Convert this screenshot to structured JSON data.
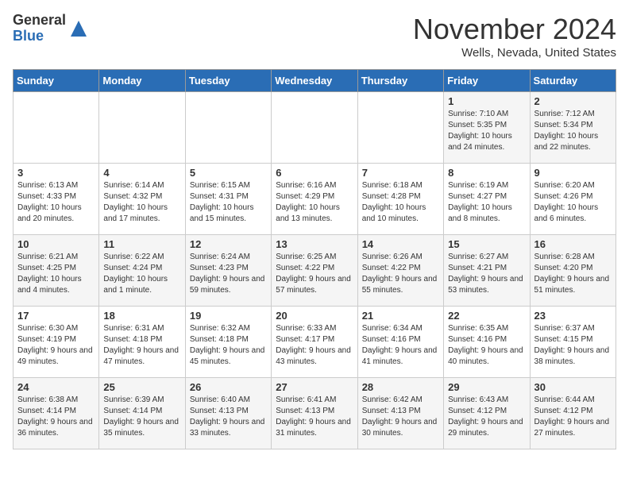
{
  "logo": {
    "general": "General",
    "blue": "Blue"
  },
  "title": "November 2024",
  "location": "Wells, Nevada, United States",
  "days_of_week": [
    "Sunday",
    "Monday",
    "Tuesday",
    "Wednesday",
    "Thursday",
    "Friday",
    "Saturday"
  ],
  "weeks": [
    [
      {
        "day": "",
        "info": ""
      },
      {
        "day": "",
        "info": ""
      },
      {
        "day": "",
        "info": ""
      },
      {
        "day": "",
        "info": ""
      },
      {
        "day": "",
        "info": ""
      },
      {
        "day": "1",
        "info": "Sunrise: 7:10 AM\nSunset: 5:35 PM\nDaylight: 10 hours and 24 minutes."
      },
      {
        "day": "2",
        "info": "Sunrise: 7:12 AM\nSunset: 5:34 PM\nDaylight: 10 hours and 22 minutes."
      }
    ],
    [
      {
        "day": "3",
        "info": "Sunrise: 6:13 AM\nSunset: 4:33 PM\nDaylight: 10 hours and 20 minutes."
      },
      {
        "day": "4",
        "info": "Sunrise: 6:14 AM\nSunset: 4:32 PM\nDaylight: 10 hours and 17 minutes."
      },
      {
        "day": "5",
        "info": "Sunrise: 6:15 AM\nSunset: 4:31 PM\nDaylight: 10 hours and 15 minutes."
      },
      {
        "day": "6",
        "info": "Sunrise: 6:16 AM\nSunset: 4:29 PM\nDaylight: 10 hours and 13 minutes."
      },
      {
        "day": "7",
        "info": "Sunrise: 6:18 AM\nSunset: 4:28 PM\nDaylight: 10 hours and 10 minutes."
      },
      {
        "day": "8",
        "info": "Sunrise: 6:19 AM\nSunset: 4:27 PM\nDaylight: 10 hours and 8 minutes."
      },
      {
        "day": "9",
        "info": "Sunrise: 6:20 AM\nSunset: 4:26 PM\nDaylight: 10 hours and 6 minutes."
      }
    ],
    [
      {
        "day": "10",
        "info": "Sunrise: 6:21 AM\nSunset: 4:25 PM\nDaylight: 10 hours and 4 minutes."
      },
      {
        "day": "11",
        "info": "Sunrise: 6:22 AM\nSunset: 4:24 PM\nDaylight: 10 hours and 1 minute."
      },
      {
        "day": "12",
        "info": "Sunrise: 6:24 AM\nSunset: 4:23 PM\nDaylight: 9 hours and 59 minutes."
      },
      {
        "day": "13",
        "info": "Sunrise: 6:25 AM\nSunset: 4:22 PM\nDaylight: 9 hours and 57 minutes."
      },
      {
        "day": "14",
        "info": "Sunrise: 6:26 AM\nSunset: 4:22 PM\nDaylight: 9 hours and 55 minutes."
      },
      {
        "day": "15",
        "info": "Sunrise: 6:27 AM\nSunset: 4:21 PM\nDaylight: 9 hours and 53 minutes."
      },
      {
        "day": "16",
        "info": "Sunrise: 6:28 AM\nSunset: 4:20 PM\nDaylight: 9 hours and 51 minutes."
      }
    ],
    [
      {
        "day": "17",
        "info": "Sunrise: 6:30 AM\nSunset: 4:19 PM\nDaylight: 9 hours and 49 minutes."
      },
      {
        "day": "18",
        "info": "Sunrise: 6:31 AM\nSunset: 4:18 PM\nDaylight: 9 hours and 47 minutes."
      },
      {
        "day": "19",
        "info": "Sunrise: 6:32 AM\nSunset: 4:18 PM\nDaylight: 9 hours and 45 minutes."
      },
      {
        "day": "20",
        "info": "Sunrise: 6:33 AM\nSunset: 4:17 PM\nDaylight: 9 hours and 43 minutes."
      },
      {
        "day": "21",
        "info": "Sunrise: 6:34 AM\nSunset: 4:16 PM\nDaylight: 9 hours and 41 minutes."
      },
      {
        "day": "22",
        "info": "Sunrise: 6:35 AM\nSunset: 4:16 PM\nDaylight: 9 hours and 40 minutes."
      },
      {
        "day": "23",
        "info": "Sunrise: 6:37 AM\nSunset: 4:15 PM\nDaylight: 9 hours and 38 minutes."
      }
    ],
    [
      {
        "day": "24",
        "info": "Sunrise: 6:38 AM\nSunset: 4:14 PM\nDaylight: 9 hours and 36 minutes."
      },
      {
        "day": "25",
        "info": "Sunrise: 6:39 AM\nSunset: 4:14 PM\nDaylight: 9 hours and 35 minutes."
      },
      {
        "day": "26",
        "info": "Sunrise: 6:40 AM\nSunset: 4:13 PM\nDaylight: 9 hours and 33 minutes."
      },
      {
        "day": "27",
        "info": "Sunrise: 6:41 AM\nSunset: 4:13 PM\nDaylight: 9 hours and 31 minutes."
      },
      {
        "day": "28",
        "info": "Sunrise: 6:42 AM\nSunset: 4:13 PM\nDaylight: 9 hours and 30 minutes."
      },
      {
        "day": "29",
        "info": "Sunrise: 6:43 AM\nSunset: 4:12 PM\nDaylight: 9 hours and 29 minutes."
      },
      {
        "day": "30",
        "info": "Sunrise: 6:44 AM\nSunset: 4:12 PM\nDaylight: 9 hours and 27 minutes."
      }
    ]
  ]
}
